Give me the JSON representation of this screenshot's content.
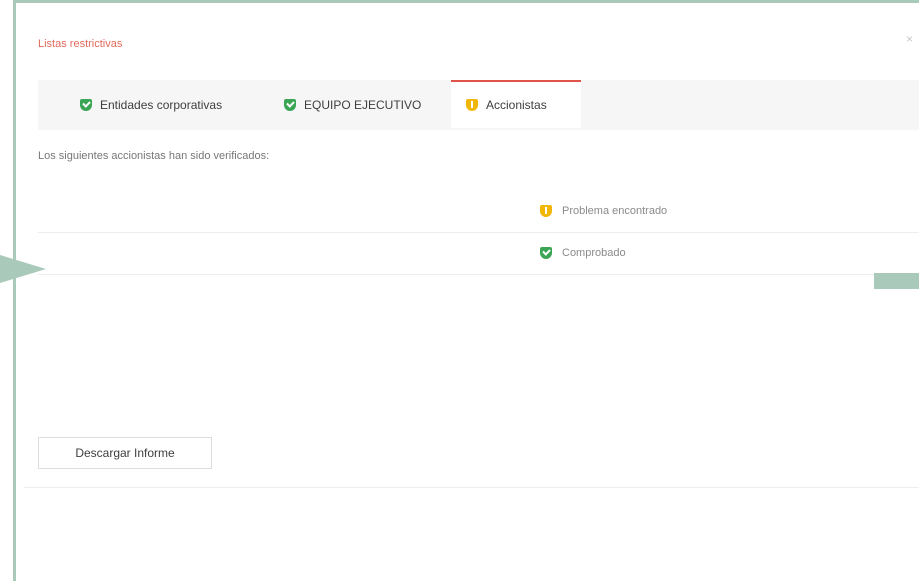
{
  "dialog": {
    "title": "Listas restrictivas",
    "close_label": "×"
  },
  "tabs": [
    {
      "label": "Entidades corporativas",
      "icon": "shield-check-icon",
      "status_color": "#3aa655"
    },
    {
      "label": "EQUIPO EJECUTIVO",
      "icon": "shield-check-icon",
      "status_color": "#3aa655"
    },
    {
      "label": "Accionistas",
      "icon": "shield-alert-icon",
      "status_color": "#f2b705",
      "active": true
    }
  ],
  "content": {
    "subtitle": "Los siguientes accionistas han sido verificados:",
    "rows": [
      {
        "status": "Problema encontrado",
        "icon": "shield-alert-icon"
      },
      {
        "status": "Comprobado",
        "icon": "shield-check-icon"
      }
    ]
  },
  "actions": {
    "download_label": "Descargar Informe"
  },
  "colors": {
    "accent_red": "#e06a5c",
    "frame_green": "#a9c9ba",
    "ok_green": "#3aa655",
    "warn_yellow": "#f2b705"
  }
}
